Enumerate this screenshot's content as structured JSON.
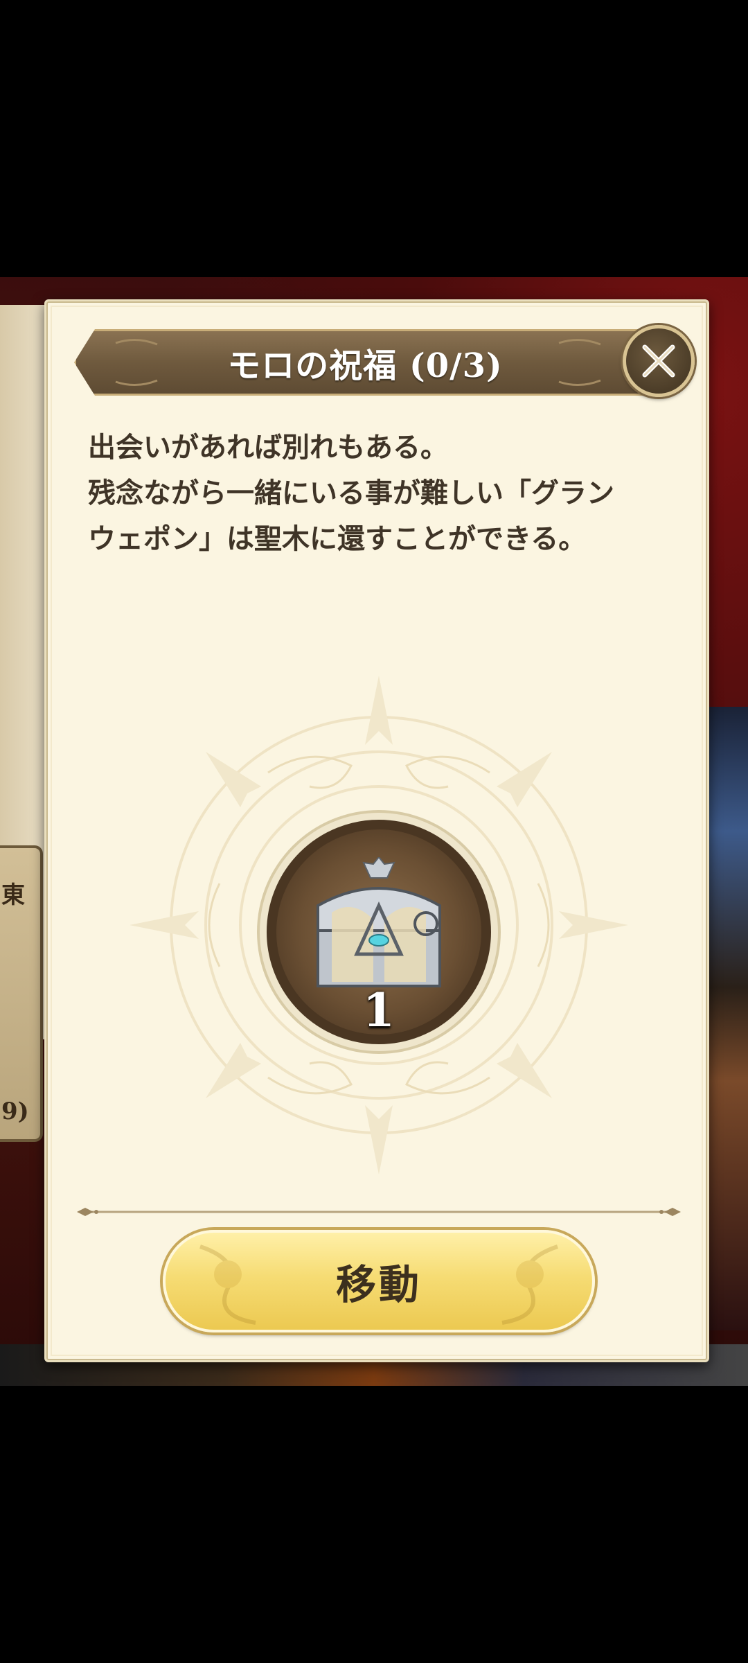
{
  "dialog": {
    "title": "モロの祝福 (0/3)",
    "description_lines": [
      "出会いがあれば別れもある。",
      "残念ながら一緒にいる事が難しい「グラン",
      "ウェポン」は聖木に還すことができる。"
    ],
    "item": {
      "icon": "treasure-chest-icon",
      "count": "1"
    },
    "move_button_label": "移動",
    "close_icon": "close-icon"
  },
  "background": {
    "left_card_lines": [
      "東",
      "9)"
    ]
  },
  "colors": {
    "panel": "#fbf5e1",
    "banner": "#6f5a3e",
    "button_gold": "#f6dc74",
    "text_dark": "#3f3427"
  }
}
